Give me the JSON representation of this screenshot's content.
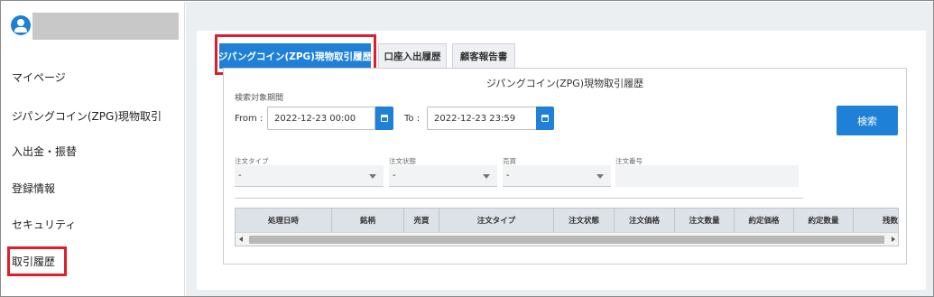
{
  "sidebar": {
    "items": [
      {
        "label": "マイページ"
      },
      {
        "label": "ジパングコイン(ZPG)現物取引"
      },
      {
        "label": "入出金・振替"
      },
      {
        "label": "登録情報"
      },
      {
        "label": "セキュリティ"
      },
      {
        "label": "取引履歴"
      }
    ]
  },
  "tabs": [
    {
      "label": "ジパングコイン(ZPG)現物取引履歴",
      "active": true
    },
    {
      "label": "口座入出履歴",
      "active": false
    },
    {
      "label": "顧客報告書",
      "active": false
    }
  ],
  "panel": {
    "title": "ジパングコイン(ZPG)現物取引履歴",
    "search_period_label": "検索対象期間",
    "from_label": "From :",
    "from_value": "2022-12-23 00:00",
    "to_label": "To :",
    "to_value": "2022-12-23 23:59",
    "search_button": "検索"
  },
  "filters": [
    {
      "label": "注文タイプ",
      "value": "-"
    },
    {
      "label": "注文状態",
      "value": "-"
    },
    {
      "label": "売買",
      "value": "-"
    },
    {
      "label": "注文番号",
      "value": ""
    }
  ],
  "table": {
    "columns": [
      "処理日時",
      "銘柄",
      "売買",
      "注文タイプ",
      "注文状態",
      "注文価格",
      "注文数量",
      "約定価格",
      "約定数量",
      "残数量"
    ]
  },
  "colors": {
    "accent": "#1f80d8",
    "highlight": "#e01e2b"
  }
}
